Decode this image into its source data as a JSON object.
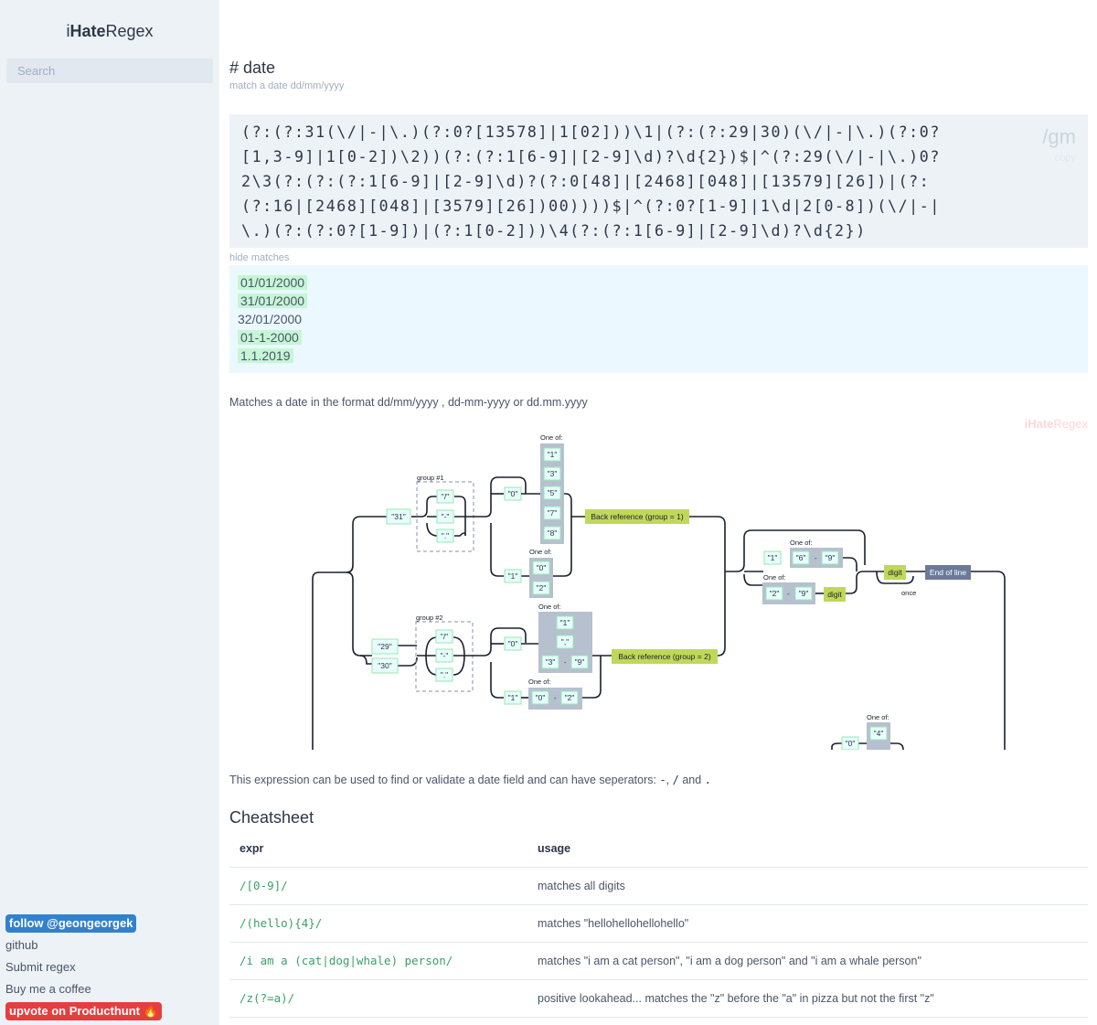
{
  "sidebar": {
    "logo_prefix": "i",
    "logo_bold": "Hate",
    "logo_suffix": "Regex",
    "search_placeholder": "Search",
    "links": {
      "twitter": "follow @geongeorgek",
      "github": "github",
      "submit": "Submit regex",
      "coffee": "Buy me a coffee",
      "producthunt": "upvote on Producthunt 🔥"
    }
  },
  "main": {
    "title": "# date",
    "subtitle": "match a date dd/mm/yyyy",
    "regex": "(?:(?:31(\\/|-|\\.)(?:0?[13578]|1[02]))\\1|(?:(?:29|30)(\\/|-|\\.)(?:0?[1,3-9]|1[0-2])\\2))(?:(?:1[6-9]|[2-9]\\d)?\\d{2})$|^(?:29(\\/|-|\\.)0?2\\3(?:(?:(?:1[6-9]|[2-9]\\d)?(?:0[48]|[2468][048]|[13579][26])|(?:(?:16|[2468][048]|[3579][26])00))))$|^(?:0?[1-9]|1\\d|2[0-8])(\\/|-|\\.)(?:(?:0?[1-9])|(?:1[0-2]))\\4(?:(?:1[6-9]|[2-9]\\d)?\\d{2})",
    "flags": "/gm",
    "copy_label": "copy",
    "hide_matches_label": "hide matches",
    "tests": [
      {
        "text": "01/01/2000",
        "match": true
      },
      {
        "text": "31/01/2000",
        "match": true
      },
      {
        "text": "32/01/2000",
        "match": false
      },
      {
        "text": "01-1-2000",
        "match": true
      },
      {
        "text": "1.1.2019",
        "match": true
      }
    ],
    "description": "Matches a date in the format dd/mm/yyyy , dd-mm-yyyy or dd.mm.yyyy",
    "watermark_bold": "iHate",
    "watermark_rest": "Regex",
    "usage_note_prefix": "This expression can be used to find or validate a date field and can have seperators: ",
    "usage_note_sep1": "-",
    "usage_note_sep2": "/",
    "usage_note_and": " and ",
    "usage_note_sep3": "."
  },
  "diagram": {
    "one_of": "One of:",
    "group1": "group #1",
    "group2": "group #2",
    "backref1": "Back reference (group = 1)",
    "backref2": "Back reference (group = 2)",
    "digit": "digit",
    "end_of_line": "End of line",
    "once": "once",
    "dash": "-",
    "lit_31": "\"31\"",
    "lit_29": "\"29\"",
    "lit_30": "\"30\"",
    "lit_0": "\"0\"",
    "lit_1": "\"1\"",
    "lit_2": "\"2\"",
    "lit_3": "\"3\"",
    "lit_4": "\"4\"",
    "lit_5": "\"5\"",
    "lit_6": "\"6\"",
    "lit_7": "\"7\"",
    "lit_8": "\"8\"",
    "lit_9": "\"9\"",
    "lit_slash": "\"/\"",
    "lit_dash": "\"-\"",
    "lit_dot": "\".\"",
    "lit_comma": "\",\""
  },
  "cheatsheet": {
    "title": "Cheatsheet",
    "headers": {
      "expr": "expr",
      "usage": "usage"
    },
    "rows": [
      {
        "expr": "/[0-9]/",
        "usage": "matches all digits"
      },
      {
        "expr": "/(hello){4}/",
        "usage": "matches \"hellohellohellohello\""
      },
      {
        "expr": "/i am a (cat|dog|whale) person/",
        "usage": "matches \"i am a cat person\", \"i am a dog person\" and \"i am a whale person\""
      },
      {
        "expr": "/z(?=a)/",
        "usage": "positive lookahead... matches the \"z\" before the \"a\" in pizza but not the first \"z\""
      }
    ]
  },
  "colors": {
    "sidebar_bg": "#edf2f7",
    "match_highlight": "#c6f6d5",
    "tests_bg": "#ebf8ff",
    "backref_green": "#c0d85a",
    "end_of_line": "#6b7a99",
    "twitter_pill": "#3182ce",
    "producthunt_pill": "#e53e3e"
  }
}
